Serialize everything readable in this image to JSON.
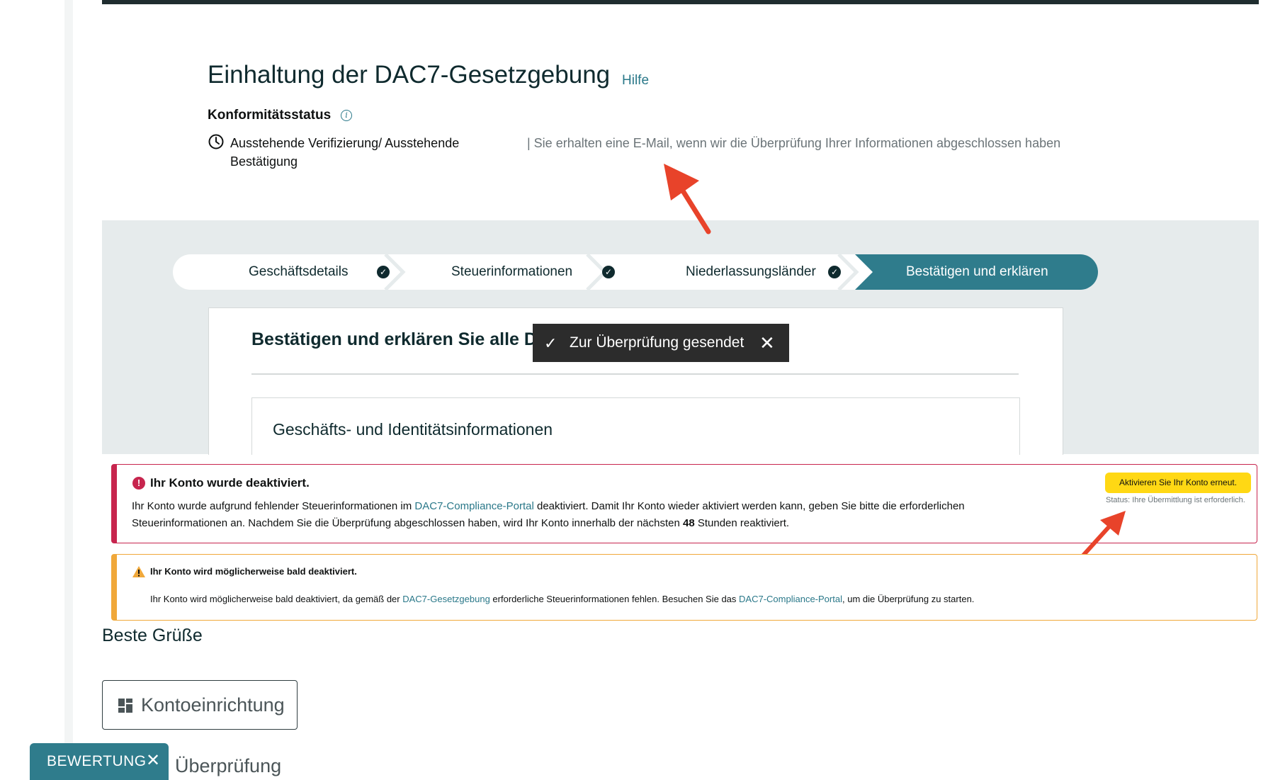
{
  "header": {
    "title": "Einhaltung der DAC7-Gesetzgebung",
    "help_link": "Hilfe"
  },
  "compliance": {
    "status_label": "Konformitätsstatus",
    "info_icon": "i",
    "status_text": "Ausstehende Verifizierung/ Ausstehende Bestätigung",
    "status_note": "| Sie erhalten eine E-Mail, wenn wir die Überprüfung Ihrer Informationen abgeschlossen haben"
  },
  "stepper": {
    "steps": [
      {
        "label": "Geschäftsdetails",
        "done": true
      },
      {
        "label": "Steuerinformationen",
        "done": true
      },
      {
        "label": "Niederlassungsländer",
        "done": true
      },
      {
        "label": "Bestätigen und erklären",
        "active": true
      }
    ]
  },
  "card": {
    "title": "Bestätigen und erklären Sie alle Details",
    "section_title": "Geschäfts- und Identitätsinformationen"
  },
  "toast": {
    "text": "Zur Überprüfung gesendet"
  },
  "alert_deactivated": {
    "title": "Ihr Konto wurde deaktiviert.",
    "body_1": "Ihr Konto wurde aufgrund fehlender Steuerinformationen im ",
    "link": "DAC7-Compliance-Portal",
    "body_2": " deaktiviert. Damit Ihr Konto wieder aktiviert werden kann, geben Sie bitte die erforderlichen Steuerinformationen an. Nachdem Sie die Überprüfung abgeschlossen haben, wird Ihr Konto innerhalb der nächsten ",
    "hours": "48",
    "body_3": " Stunden reaktiviert.",
    "button": "Aktivieren Sie Ihr Konto erneut.",
    "status": "Status: Ihre Übermittlung ist erforderlich."
  },
  "alert_warning": {
    "title": "Ihr Konto wird möglicherweise bald deaktiviert.",
    "body_1": "Ihr Konto wird möglicherweise bald deaktiviert, da gemäß der ",
    "link_1": "DAC7-Gesetzgebung",
    "body_2": " erforderliche Steuerinformationen fehlen. Besuchen Sie das ",
    "link_2": "DAC7-Compliance-Portal",
    "body_3": ", um die Überprüfung zu starten."
  },
  "greeting": "Beste Grüße",
  "setup_button": "Kontoeinrichtung",
  "lower_text": ": Überprüfung",
  "rating_tab": {
    "label": "BEWERTUNG",
    "close": "✕"
  },
  "colors": {
    "accent": "#2f7c8c",
    "link": "#2a7889",
    "error": "#c7254e",
    "warning": "#f0a83a",
    "button_yellow": "#ffd814",
    "annotation_arrow": "#e8432a"
  }
}
